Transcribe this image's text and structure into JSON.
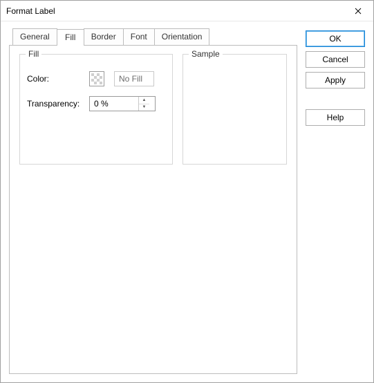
{
  "window": {
    "title": "Format Label"
  },
  "tabs": {
    "general": "General",
    "fill": "Fill",
    "border": "Border",
    "font": "Font",
    "orientation": "Orientation",
    "active": "fill"
  },
  "fill_group": {
    "legend": "Fill",
    "color_label": "Color:",
    "color_value": "No Fill",
    "transparency_label": "Transparency:",
    "transparency_value": "0 %"
  },
  "sample_group": {
    "legend": "Sample"
  },
  "buttons": {
    "ok": "OK",
    "cancel": "Cancel",
    "apply": "Apply",
    "help": "Help"
  }
}
